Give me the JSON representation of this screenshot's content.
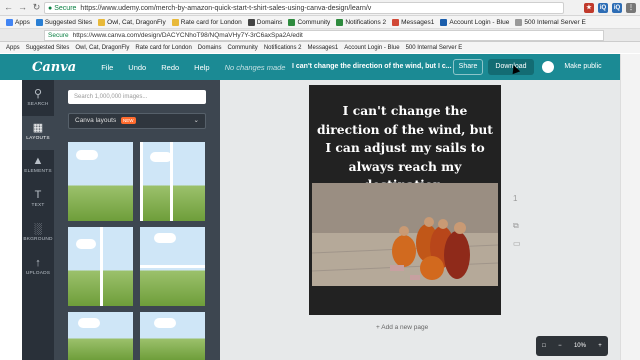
{
  "browser": {
    "secure_label": "Secure",
    "url_main": "https://www.udemy.com/merch-by-amazon-quick-start-t-shirt-sales-using-canva-design/learn/v",
    "url_embedded": "https://www.canva.com/design/DACYCNhoT98/NQmaVHy7Y-3rC6axSpa2A/edit",
    "bookmarks": [
      "Apps",
      "Suggested Sites",
      "Owl, Cat, DragonFly",
      "Rate card for London",
      "Domains",
      "Community",
      "Notifications 2",
      "Messages1",
      "Account Login - Blue",
      "500 Internal Server E"
    ],
    "bookmarks_inner": [
      "Apps",
      "Suggested Sites",
      "Owl, Cat, DragonFly",
      "Rate card for London",
      "Domains",
      "Community",
      "Notifications 2",
      "Messages1",
      "Account Login - Blue",
      "500 Internal Server E"
    ],
    "ext_icons": [
      "iQ",
      "iQ"
    ]
  },
  "topbar": {
    "logo": "Canva",
    "menu": [
      "File",
      "Undo",
      "Redo",
      "Help"
    ],
    "status": "No changes made",
    "doc_title": "I can't change the direction of the wind, but I c...",
    "share": "Share",
    "download": "Download",
    "make_public": "Make public"
  },
  "rail": [
    {
      "label": "SEARCH",
      "icon": "search-icon"
    },
    {
      "label": "LAYOUTS",
      "icon": "layouts-icon"
    },
    {
      "label": "ELEMENTS",
      "icon": "elements-icon"
    },
    {
      "label": "TEXT",
      "icon": "text-icon"
    },
    {
      "label": "BKGROUND",
      "icon": "background-icon"
    },
    {
      "label": "UPLOADS",
      "icon": "uploads-icon"
    }
  ],
  "panel": {
    "search_placeholder": "Search 1,000,000 images...",
    "dropdown_label": "Canva layouts",
    "new_badge": "NEW"
  },
  "canvas": {
    "quote": "I can't change the direction of the wind, but I can adjust my sails to always reach my destination.",
    "add_page": "+ Add a new page",
    "page_number": "1"
  },
  "zoom": {
    "level": "10%"
  },
  "colors": {
    "topbar": "#1b8a94",
    "rail": "#293039",
    "panel": "#3d4650",
    "accent": "#ff6b2d"
  }
}
